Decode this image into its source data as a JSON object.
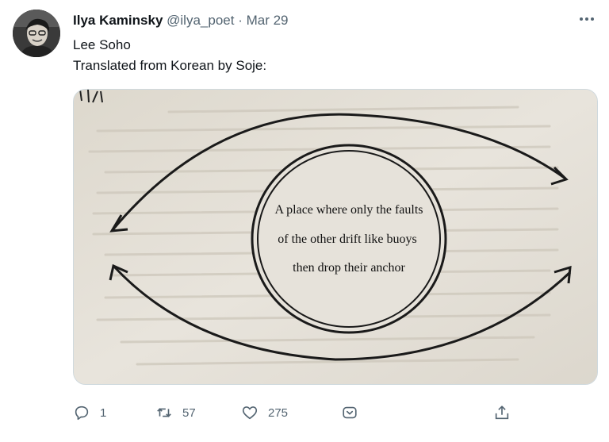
{
  "tweet": {
    "author_name": "Ilya Kaminsky",
    "handle": "@ilya_poet",
    "separator": "·",
    "date": "Mar 29",
    "text_line1": "Lee Soho",
    "text_line2": "Translated from Korean by Soje:"
  },
  "media": {
    "poem_line1": "A place where only the faults",
    "poem_line2": "of the other drift like buoys",
    "poem_line3": "then drop their anchor"
  },
  "actions": {
    "reply_count": "1",
    "retweet_count": "57",
    "like_count": "275"
  },
  "icons": {
    "more": "more-horizontal-icon",
    "reply": "reply-icon",
    "retweet": "retweet-icon",
    "like": "heart-icon",
    "bookmark": "bookmark-icon",
    "share": "share-icon"
  },
  "colors": {
    "text": "#0f1419",
    "secondary": "#536471",
    "paper": "#e5e1d8"
  }
}
